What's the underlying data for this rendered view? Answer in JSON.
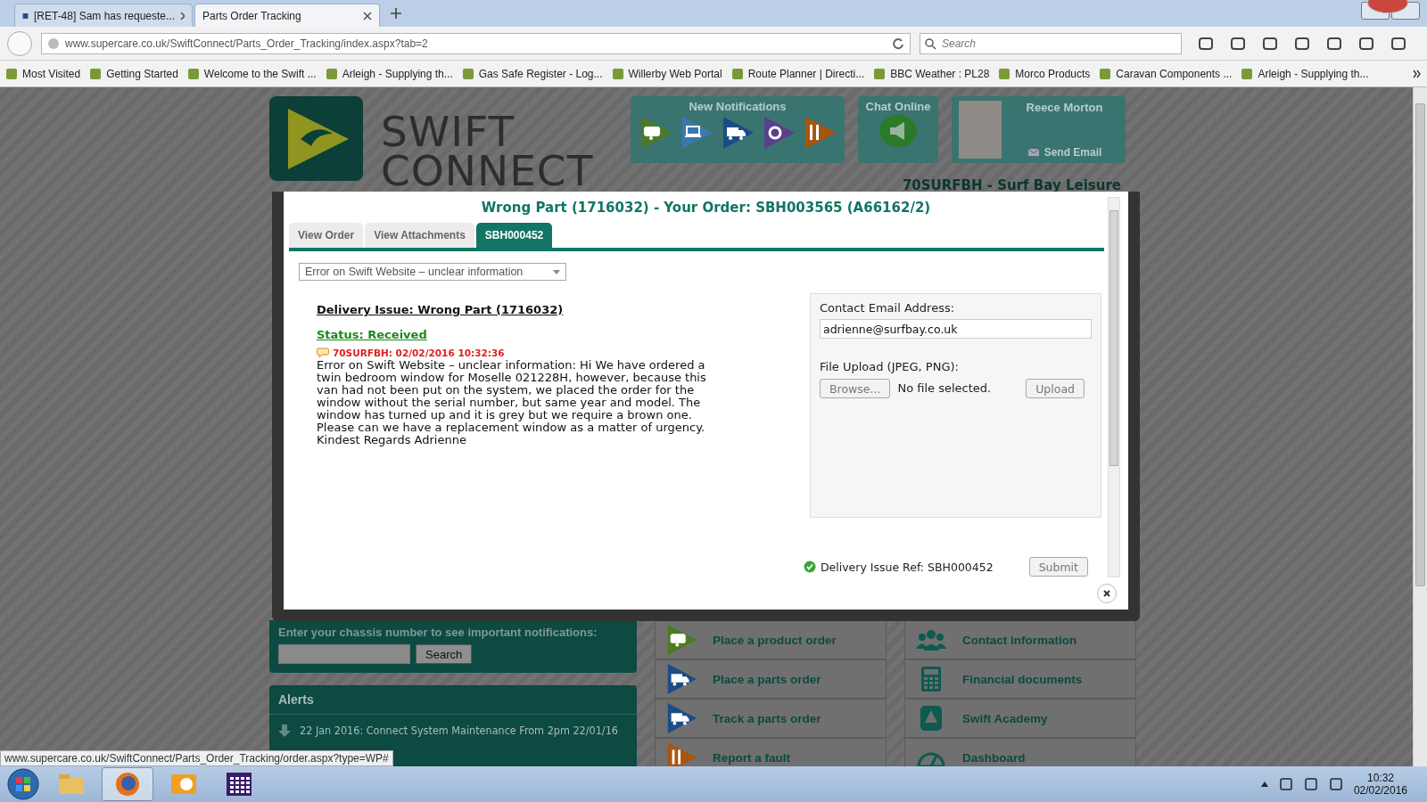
{
  "browser": {
    "tabs": [
      {
        "label": "[RET-48] Sam has requeste...",
        "selected": false
      },
      {
        "label": "Parts Order Tracking",
        "selected": true
      }
    ],
    "url": "www.supercare.co.uk/SwiftConnect/Parts_Order_Tracking/index.aspx?tab=2",
    "search_placeholder": "Search",
    "bookmarks": [
      "Most Visited",
      "Getting Started",
      "Welcome to the Swift ...",
      "Arleigh - Supplying th...",
      "Gas Safe Register - Log...",
      "Willerby Web Portal",
      "Route Planner | Directi...",
      "BBC Weather : PL28",
      "Morco Products",
      "Caravan Components ...",
      "Arleigh - Supplying th..."
    ]
  },
  "page": {
    "logo_lines": [
      "SWIFT",
      "CONNECT"
    ],
    "notifications_title": "New Notifications",
    "chat_title": "Chat Online",
    "user_name": "Reece Morton",
    "send_email": "Send Email",
    "account": "70SURFBH - Surf Bay Leisure",
    "chassis_prompt": "Enter your chassis number to see important notifications:",
    "chassis_button": "Search",
    "alerts_title": "Alerts",
    "alerts": [
      "22 Jan 2016: Connect System Maintenance From 2pm 22/01/16"
    ],
    "menu_left": [
      {
        "label": "Place a product order",
        "kind": "product"
      },
      {
        "label": "Place a parts order",
        "kind": "parts"
      },
      {
        "label": "Track a parts order",
        "kind": "track"
      },
      {
        "label": "Report a fault",
        "kind": "fault"
      }
    ],
    "menu_right": [
      {
        "label": "Contact information",
        "kind": "contacts"
      },
      {
        "label": "Financial documents",
        "kind": "finance"
      },
      {
        "label": "Swift Academy",
        "kind": "academy"
      },
      {
        "label": "Dashboard",
        "kind": "dashboard"
      }
    ]
  },
  "modal": {
    "title": "Wrong Part (1716032) - Your Order: SBH003565 (A66162/2)",
    "tabs": [
      {
        "label": "View Order",
        "selected": false
      },
      {
        "label": "View Attachments",
        "selected": false
      },
      {
        "label": "SBH000452",
        "selected": true
      }
    ],
    "issue_type": "Error on Swift Website – unclear information",
    "heading": "Delivery Issue: Wrong Part (1716032)",
    "status": "Status: Received",
    "comments": [
      {
        "meta": "70SURFBH: 02/02/2016 10:32:36",
        "text": "Error on Swift Website – unclear information: Hi We have ordered a twin bedroom window for Moselle 021228H, however, because this van had not been put on the system, we placed the order for the window without the serial number, but same year and model. The window has turned up and it is grey but we require a brown one. Please can we have a replacement window as a matter of urgency. Kindest Regards Adrienne"
      }
    ],
    "contact_label": "Contact Email Address:",
    "contact_email": "adrienne@surfbay.co.uk",
    "upload_label": "File Upload (JPEG, PNG):",
    "browse_button": "Browse...",
    "file_status": "No file selected.",
    "upload_button": "Upload",
    "reference": "Delivery Issue Ref: SBH000452",
    "submit_button": "Submit"
  },
  "status_link": "www.supercare.co.uk/SwiftConnect/Parts_Order_Tracking/order.aspx?type=WP#",
  "taskbar": {
    "time": "10:32",
    "date": "02/02/2016"
  }
}
